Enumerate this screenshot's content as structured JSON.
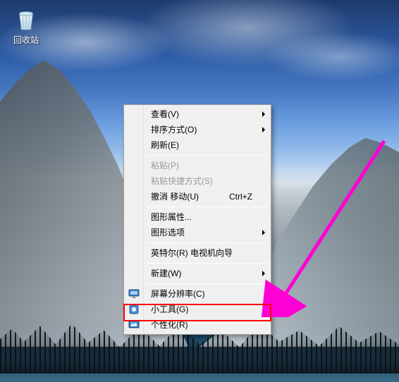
{
  "desktop": {
    "recycle_bin_label": "回收站"
  },
  "context_menu": {
    "items": [
      {
        "label": "查看(V)",
        "submenu": true
      },
      {
        "label": "排序方式(O)",
        "submenu": true
      },
      {
        "label": "刷新(E)"
      },
      {
        "sep": true
      },
      {
        "label": "粘贴(P)",
        "disabled": true
      },
      {
        "label": "粘贴快捷方式(S)",
        "disabled": true
      },
      {
        "label": "撤消 移动(U)",
        "shortcut": "Ctrl+Z"
      },
      {
        "sep": true
      },
      {
        "label": "图形属性..."
      },
      {
        "label": "图形选项",
        "submenu": true
      },
      {
        "sep": true
      },
      {
        "label": "英特尔(R) 电视机向导"
      },
      {
        "sep": true
      },
      {
        "label": "新建(W)",
        "submenu": true
      },
      {
        "sep": true
      },
      {
        "label": "屏幕分辨率(C)",
        "icon": "display"
      },
      {
        "label": "小工具(G)",
        "icon": "gadget"
      },
      {
        "label": "个性化(R)",
        "icon": "personalize",
        "highlighted": true
      }
    ]
  },
  "annotation": {
    "arrow_color": "#ff00d4",
    "highlight_color": "#ff0000"
  }
}
